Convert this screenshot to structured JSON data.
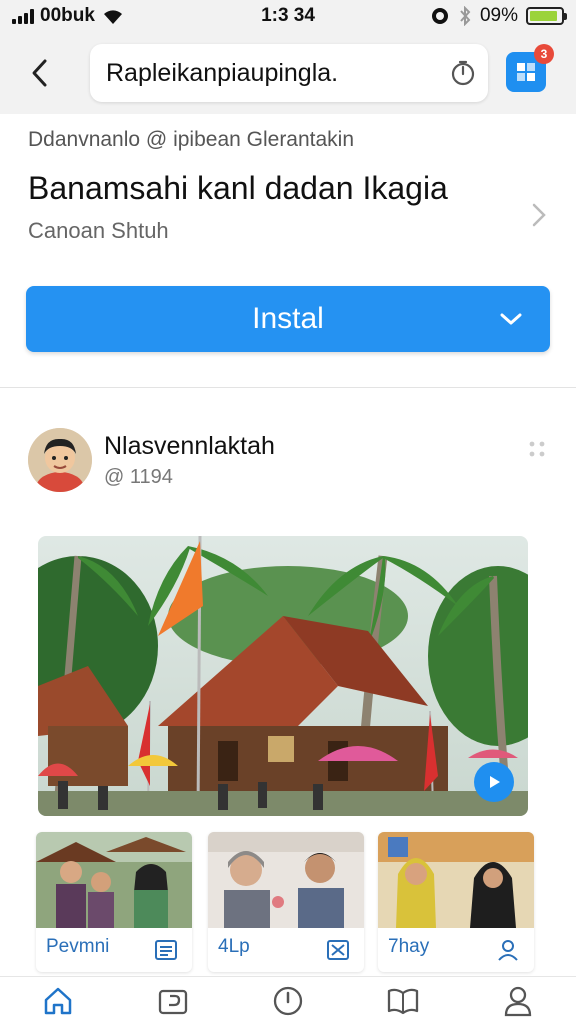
{
  "status_bar": {
    "carrier": "00buk",
    "time": "1:3 34",
    "battery_percent": "09%"
  },
  "address_bar": {
    "url": "Rapleikanpiaupingla.",
    "notification_count": "3"
  },
  "banner": {
    "meta": "Ddanvnanlo @ ipibean Glerantakin",
    "title": "Banamsahi kanl dadan Ikagia",
    "subtitle": "Canoan Shtuh",
    "install_label": "Instal"
  },
  "post": {
    "author": "Nlasvennlaktah",
    "handle": "@ 1194"
  },
  "thumbnails": [
    {
      "caption": "Pevmni",
      "icon": "list-icon"
    },
    {
      "caption": "4Lp",
      "icon": "image-x-icon"
    },
    {
      "caption": "7hay",
      "icon": "user-icon"
    }
  ],
  "bottom_nav": [
    {
      "icon": "home-icon",
      "active": true
    },
    {
      "icon": "share-icon"
    },
    {
      "icon": "clock-icon"
    },
    {
      "icon": "book-icon"
    },
    {
      "icon": "profile-icon"
    }
  ],
  "colors": {
    "accent": "#2592f2",
    "nav_active": "#1f74c9",
    "badge": "#e84a3a"
  }
}
